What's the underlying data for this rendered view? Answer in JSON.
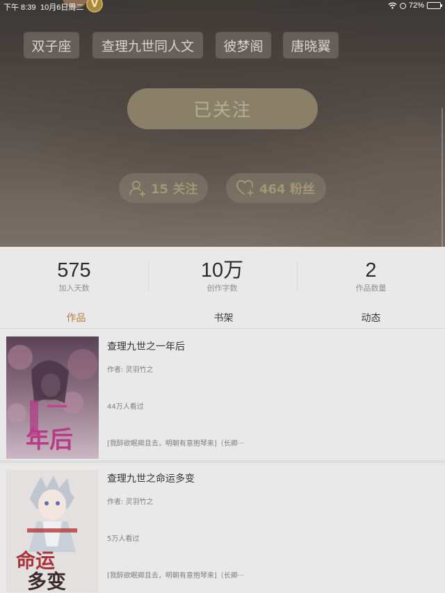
{
  "status_bar": {
    "time": "下午 8:39",
    "date": "10月6日周二",
    "battery": "72%",
    "battery_level": 0.72
  },
  "profile": {
    "badge_letter": "V",
    "tags": [
      "双子座",
      "查理九世同人文",
      "彼梦阁",
      "唐晓翼"
    ],
    "follow_button": "已关注",
    "following": "15 关注",
    "fans": "464 粉丝"
  },
  "stats": [
    {
      "value": "575",
      "label": "加入天数"
    },
    {
      "value": "10万",
      "label": "创作字数"
    },
    {
      "value": "2",
      "label": "作品数量"
    }
  ],
  "tabs": [
    {
      "label": "作品",
      "active": true
    },
    {
      "label": "书架",
      "active": false
    },
    {
      "label": "动态",
      "active": false
    }
  ],
  "books": [
    {
      "title": "查理九世之一年后",
      "author": "作者: 灵羽竹之",
      "views": "44万人看过",
      "desc": "[我醉欲眠卿且去，明朝有意抱琴来]（长卿···",
      "cover_text": "一年后"
    },
    {
      "title": "查理九世之命运多变",
      "author": "作者: 灵羽竹之",
      "views": "5万人看过",
      "desc": "[我醉欲眠卿且去，明朝有意抱琴来]（长卿···",
      "cover_text": "命运多变"
    }
  ],
  "colors": {
    "accent": "#b57a3c",
    "follow_button_bg": "#8a8067",
    "background": "#e9e9e9"
  },
  "icons": {
    "following": "person-plus-icon",
    "fans": "heart-plus-icon",
    "wifi": "wifi-icon",
    "alarm": "alarm-icon",
    "battery": "battery-icon"
  }
}
